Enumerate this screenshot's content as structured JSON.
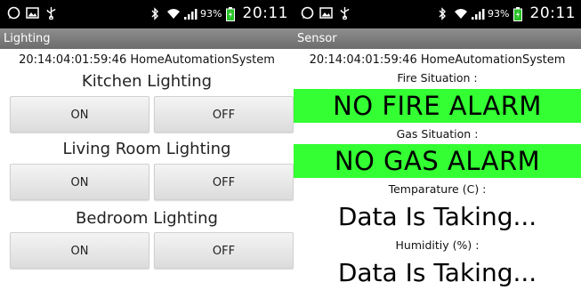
{
  "left": {
    "statusbar": {
      "time": "20:11",
      "battery": "93%"
    },
    "title": "Lighting",
    "device": "20:14:04:01:59:46 HomeAutomationSystem",
    "sections": [
      {
        "label": "Kitchen Lighting",
        "on": "ON",
        "off": "OFF"
      },
      {
        "label": "Living Room Lighting",
        "on": "ON",
        "off": "OFF"
      },
      {
        "label": "Bedroom Lighting",
        "on": "ON",
        "off": "OFF"
      }
    ]
  },
  "right": {
    "statusbar": {
      "time": "20:11",
      "battery": "93%"
    },
    "title": "Sensor",
    "device": "20:14:04:01:59:46 HomeAutomationSystem",
    "fire_label": "Fire Situation :",
    "fire_status": "NO FIRE ALARM",
    "gas_label": "Gas Situation :",
    "gas_status": "NO GAS ALARM",
    "temp_label": "Temparature (C) :",
    "temp_value": "Data Is Taking...",
    "humidity_label": "Humiditiy (%) :",
    "humidity_value": "Data Is Taking..."
  },
  "colors": {
    "alarm_green": "#33ff33",
    "titlebar": "#7d7d7d",
    "statusbar": "#000000"
  },
  "icons": [
    "whatsapp-icon",
    "gallery-icon",
    "usb-icon",
    "bluetooth-icon",
    "wifi-icon",
    "signal-icon",
    "battery-icon"
  ]
}
